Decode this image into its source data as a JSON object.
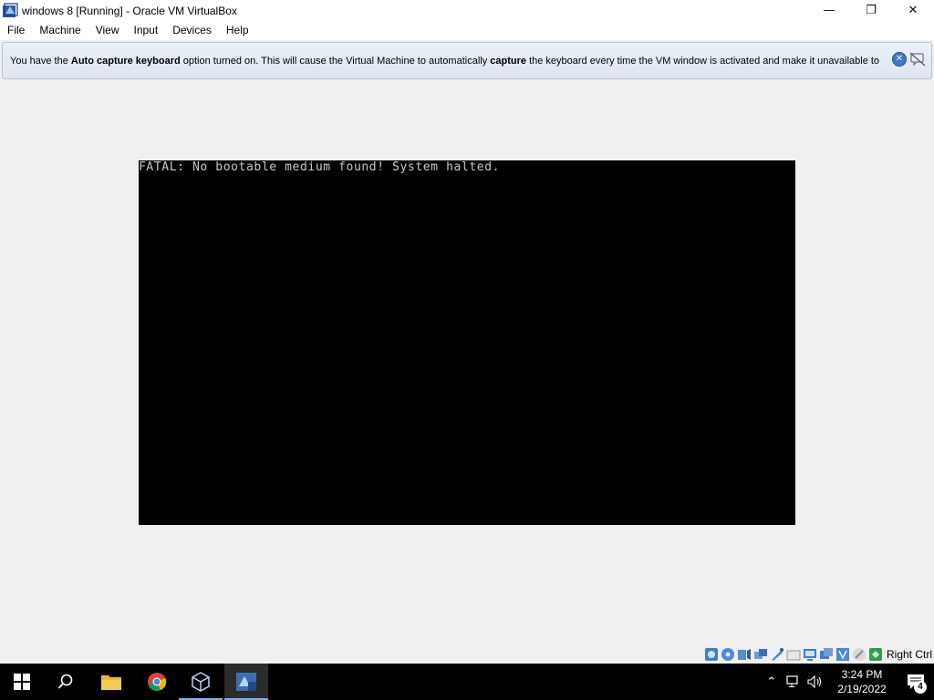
{
  "window": {
    "title": "windows 8 [Running] - Oracle VM VirtualBox",
    "icon": "virtualbox-icon",
    "controls": {
      "minimize": "—",
      "maximize": "❐",
      "close": "✕"
    }
  },
  "menubar": {
    "items": [
      "File",
      "Machine",
      "View",
      "Input",
      "Devices",
      "Help"
    ]
  },
  "notice": {
    "segments": [
      "You have the ",
      "Auto capture keyboard",
      " option turned on. This will cause the Virtual Machine to automatically ",
      "capture",
      " the keyboard every time the VM window is activated and make it unavailable to"
    ],
    "close_glyph": "✕"
  },
  "vm": {
    "console_text": "FATAL: No bootable medium found! System halted."
  },
  "statusbar": {
    "icons": [
      "hard-disk-icon",
      "optical-disk-icon",
      "audio-icon",
      "network-icon",
      "usb-icon",
      "shared-folders-icon",
      "display-icon",
      "video-capture-icon",
      "virtualization-icon",
      "mouse-integration-icon",
      "keyboard-capture-icon"
    ],
    "host_key": "Right Ctrl"
  },
  "taskbar": {
    "clock_time": "3:24 PM",
    "clock_date": "2/19/2022",
    "notification_count": "4",
    "tray_chevron": "⌃",
    "speaker_glyph": "🔊"
  },
  "colors": {
    "taskbar_bg": "#000000",
    "vm_screen_bg": "#000000",
    "console_fg": "#c8c8c8",
    "notice_bg": "#e3ebf4",
    "accent": "#7fb0e8"
  }
}
